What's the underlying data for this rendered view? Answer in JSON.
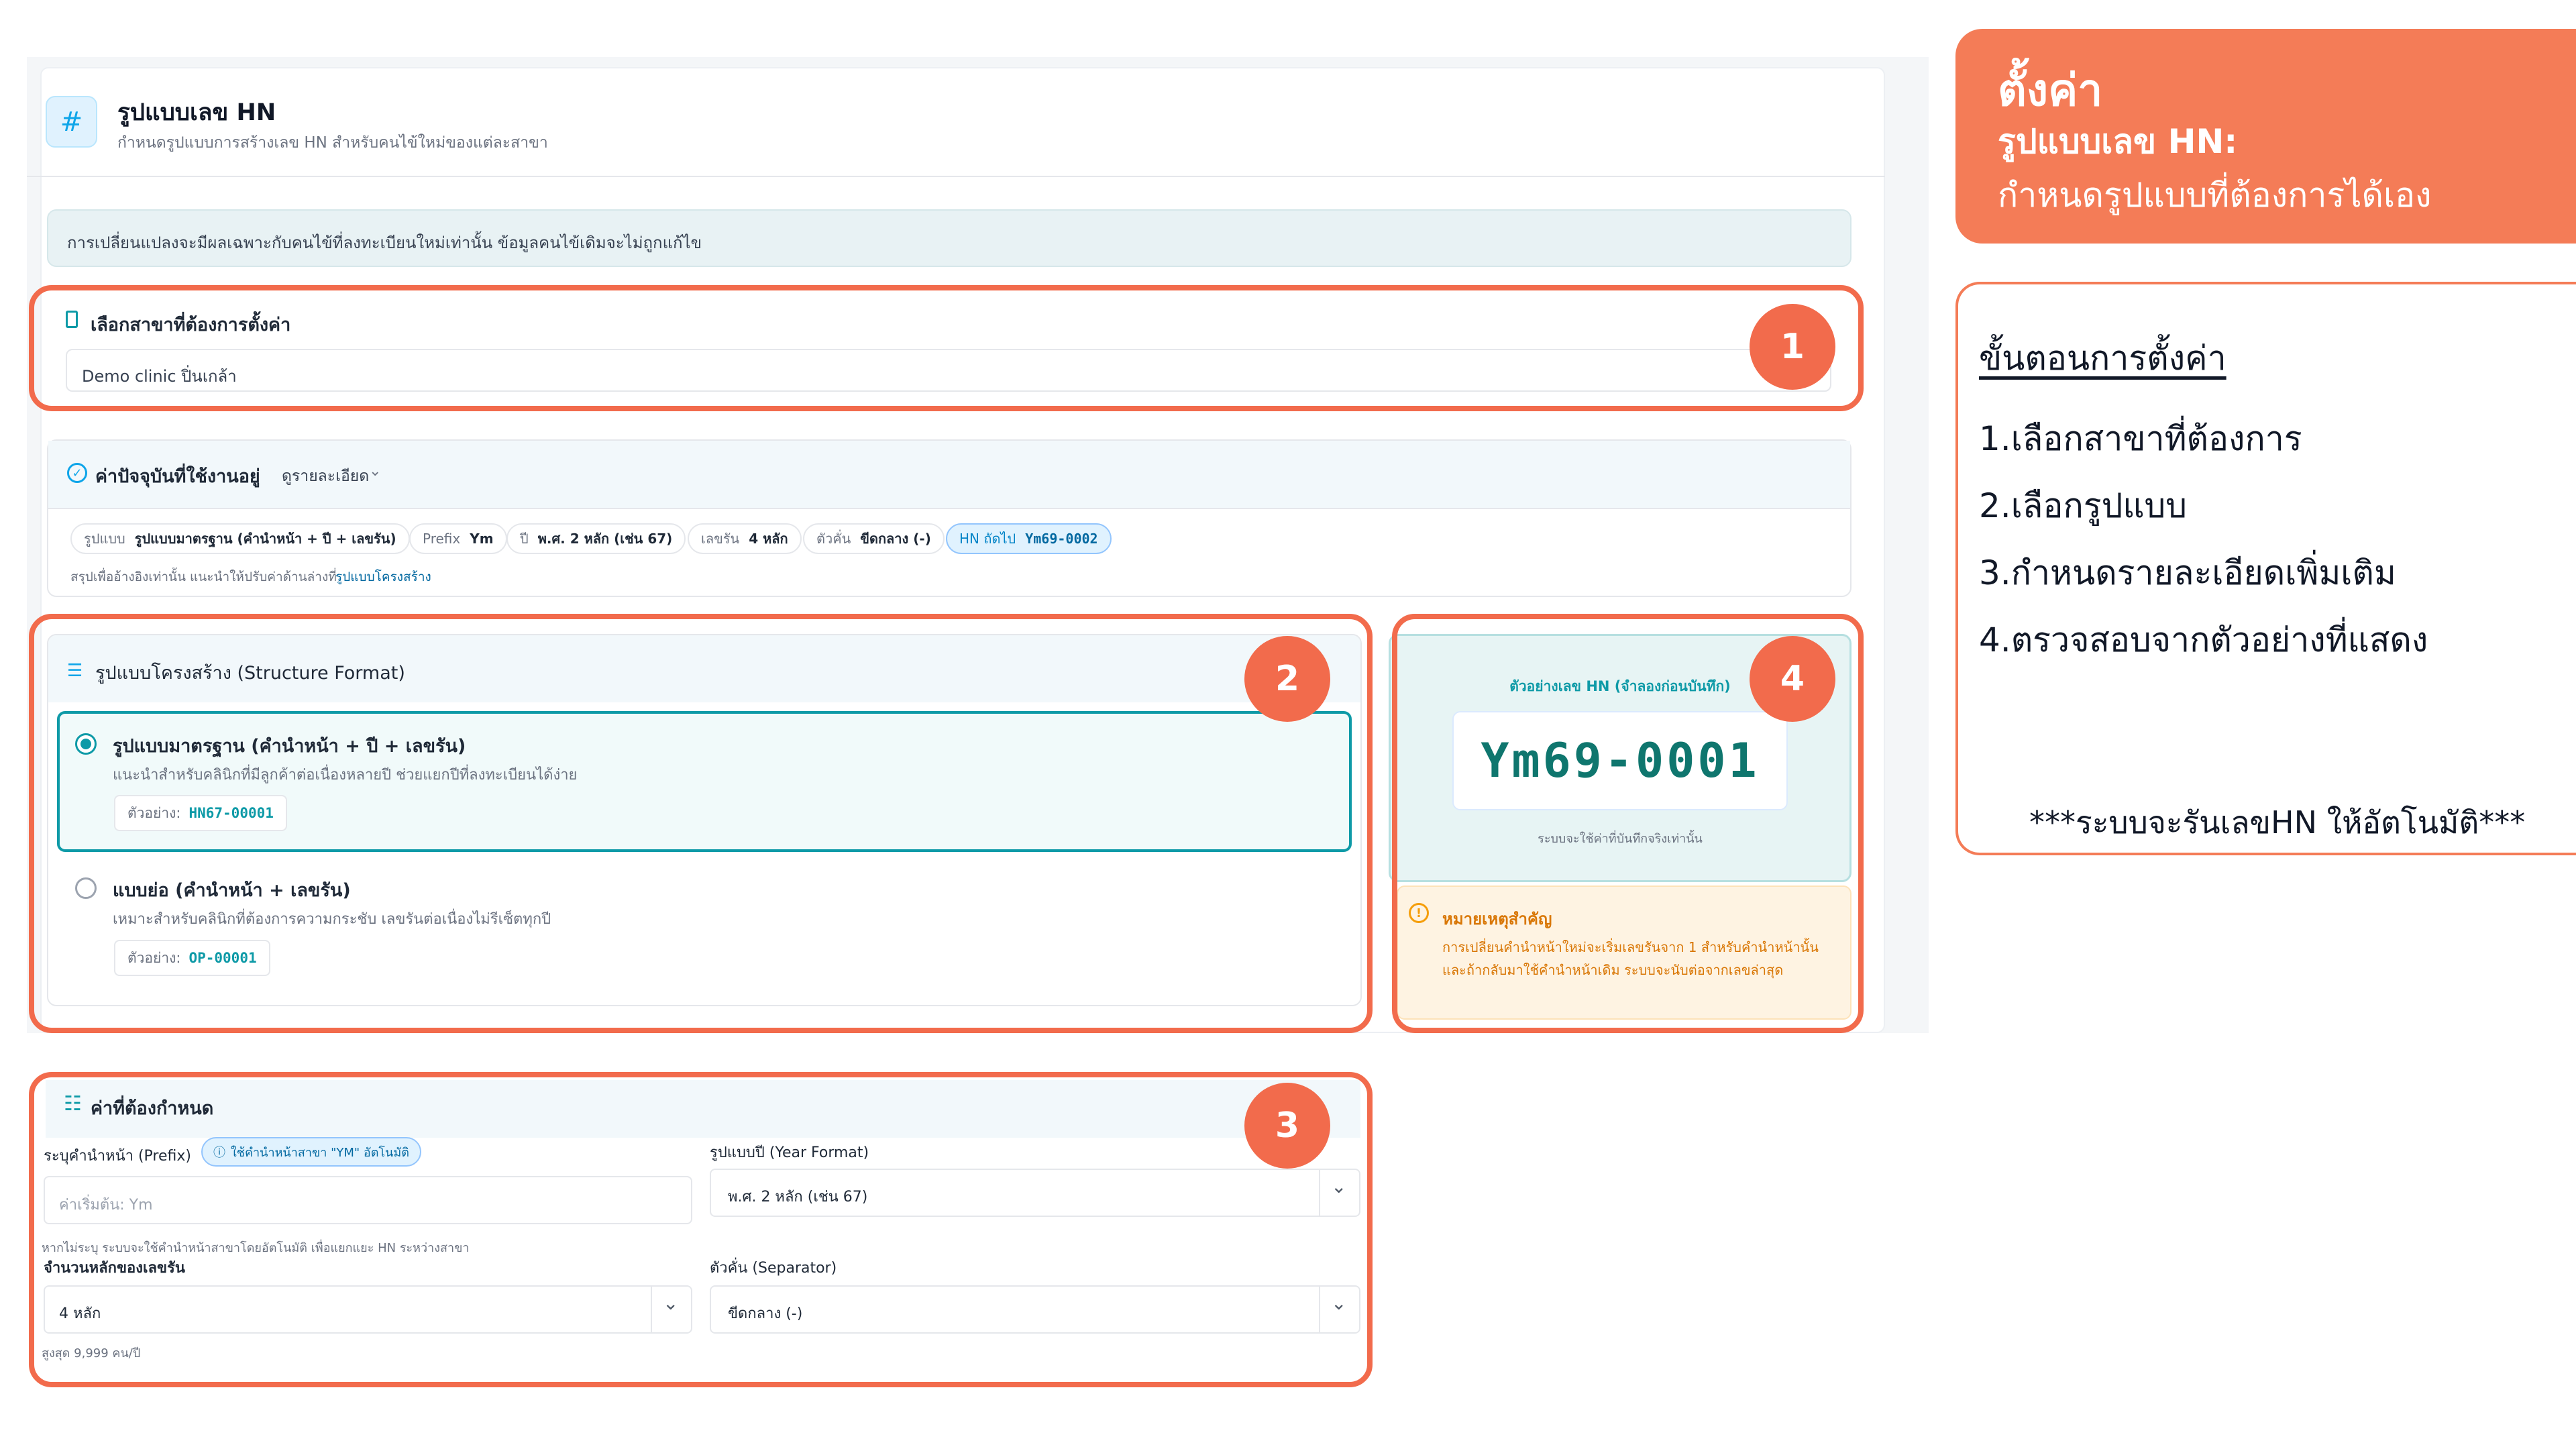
{
  "page": {
    "title": "รูปแบบเลข HN",
    "subtitle": "กำหนดรูปแบบการสร้างเลข HN สำหรับคนไข้ใหม่ของแต่ละสาขา",
    "hash_symbol": "#"
  },
  "notice": "การเปลี่ยนแปลงจะมีผลเฉพาะกับคนไข้ที่ลงทะเบียนใหม่เท่านั้น ข้อมูลคนไข้เดิมจะไม่ถูกแก้ไข",
  "branch": {
    "label": "เลือกสาขาที่ต้องการตั้งค่า",
    "value": "Demo clinic ปิ่นเกล้า"
  },
  "current": {
    "title": "ค่าปัจจุบันที่ใช้งานอยู่",
    "details_link": "ดูรายละเอียด",
    "chips": [
      {
        "key": "รูปแบบ",
        "value": "รูปแบบมาตรฐาน (คำนำหน้า + ปี + เลขรัน)"
      },
      {
        "key": "Prefix",
        "value": "Ym"
      },
      {
        "key": "ปี",
        "value": "พ.ศ. 2 หลัก (เช่น 67)"
      },
      {
        "key": "เลขรัน",
        "value": "4 หลัก"
      },
      {
        "key": "ตัวคั่น",
        "value": "ขีดกลาง (-)"
      },
      {
        "key": "HN ถัดไป",
        "value": "Ym69-0002"
      }
    ],
    "note": "สรุปเพื่ออ้างอิงเท่านั้น แนะนำให้ปรับค่าด้านล่างที่",
    "note_link": "รูปแบบโครงสร้าง"
  },
  "structure": {
    "title": "รูปแบบโครงสร้าง (Structure Format)",
    "options": [
      {
        "title": "รูปแบบมาตรฐาน (คำนำหน้า + ปี + เลขรัน)",
        "desc": "แนะนำสำหรับคลินิกที่มีลูกค้าต่อเนื่องหลายปี ช่วยแยกปีที่ลงทะเบียนได้ง่าย",
        "example_label": "ตัวอย่าง:",
        "example": "HN67-00001",
        "selected": true
      },
      {
        "title": "แบบย่อ (คำนำหน้า + เลขรัน)",
        "desc": "เหมาะสำหรับคลินิกที่ต้องการความกระชับ เลขรันต่อเนื่องไม่รีเซ็ตทุกปี",
        "example_label": "ตัวอย่าง:",
        "example": "OP-00001",
        "selected": false
      }
    ]
  },
  "preview": {
    "label": "ตัวอย่างเลข HN (จำลองก่อนบันทึก)",
    "value": "Ym69-0001",
    "note": "ระบบจะใช้ค่าที่บันทึกจริงเท่านั้น"
  },
  "warning": {
    "title": "หมายเหตุสำคัญ",
    "text": "การเปลี่ยนคำนำหน้าใหม่จะเริ่มเลขรันจาก 1 สำหรับคำนำหน้านั้น และถ้ากลับมาใช้คำนำหน้าเดิม ระบบจะนับต่อจากเลขล่าสุด"
  },
  "settings": {
    "title": "ค่าที่ต้องกำหนด",
    "prefix_label": "ระบุคำนำหน้า (Prefix)",
    "prefix_auto_chip": "ใช้คำนำหน้าสาขา \"YM\" อัตโนมัติ",
    "prefix_placeholder": "ค่าเริ่มต้น: Ym",
    "prefix_hint": "หากไม่ระบุ ระบบจะใช้คำนำหน้าสาขาโดยอัตโนมัติ เพื่อแยกแยะ HN ระหว่างสาขา",
    "year_label": "รูปแบบปี (Year Format)",
    "year_value": "พ.ศ. 2 หลัก (เช่น 67)",
    "digits_label": "จำนวนหลักของเลขรัน",
    "digits_value": "4 หลัก",
    "digits_hint": "สูงสุด 9,999 คน/ปี",
    "separator_label": "ตัวคั่น (Separator)",
    "separator_value": "ขีดกลาง (-)"
  },
  "badges": [
    "1",
    "2",
    "3",
    "4"
  ],
  "banner": {
    "title": "ตั้งค่า",
    "sub1": "รูปแบบเลข HN:",
    "sub2": "กำหนดรูปแบบที่ต้องการได้เอง"
  },
  "steps": {
    "title": "ขั้นตอนการตั้งค่า",
    "items": [
      "1.เลือกสาขาที่ต้องการ",
      "2.เลือกรูปแบบ",
      "3.กำหนดรายละเอียดเพิ่มเติม",
      "4.ตรวจสอบจากตัวอย่างที่แสดง"
    ],
    "footnote": "***ระบบจะรันเลขHN ให้อัตโนมัติ***"
  },
  "colors": {
    "accent_orange": "#f26b4c",
    "teal": "#0e9aa7",
    "banner": "#f47c57"
  },
  "icons": [
    "hash-icon",
    "building-icon",
    "check-circle-icon",
    "chevron-down-icon",
    "list-icon",
    "info-icon",
    "sliders-icon"
  ]
}
